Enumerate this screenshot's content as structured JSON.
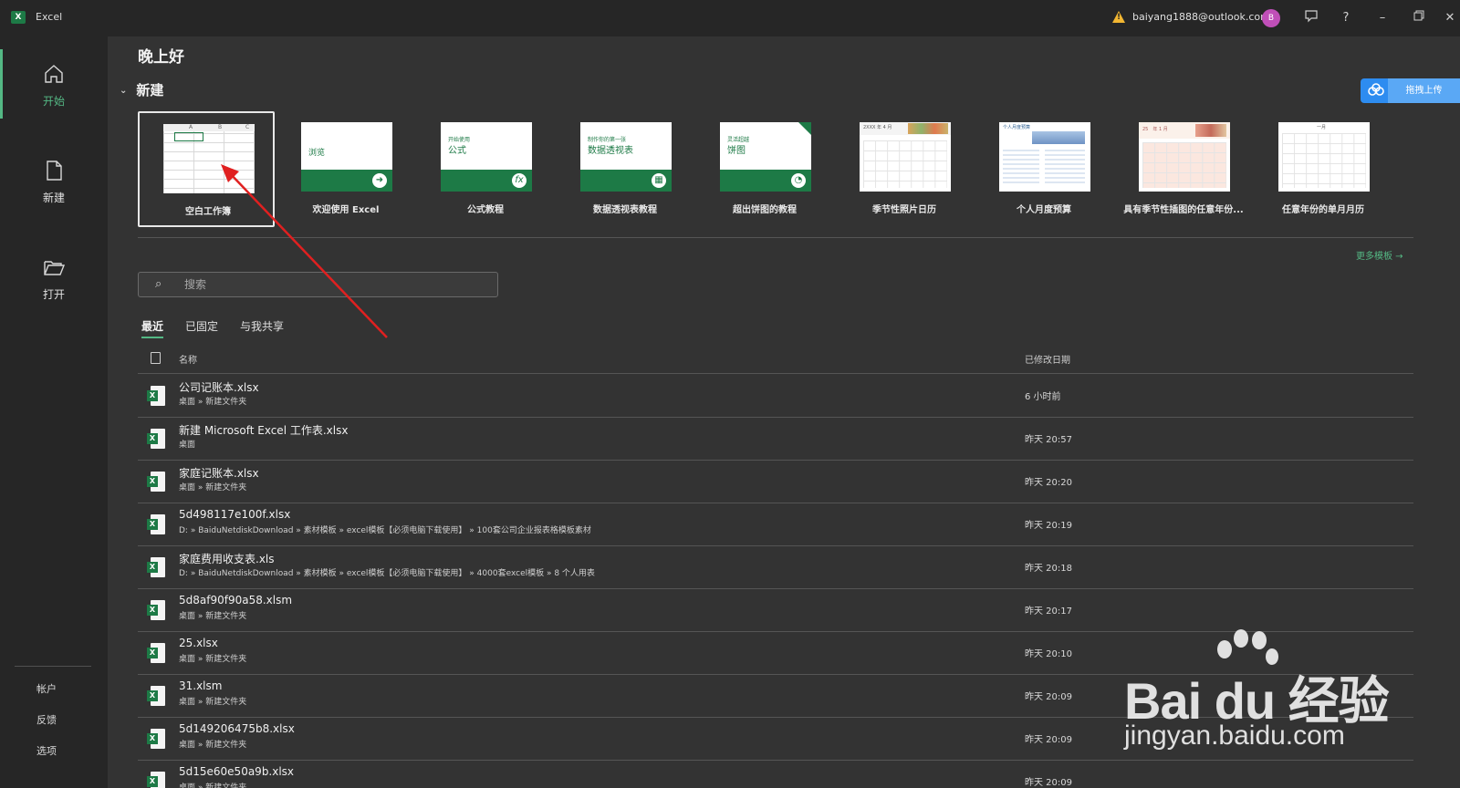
{
  "titlebar": {
    "app_name": "Excel",
    "app_logo": "X",
    "account_email": "baiyang1888@outlook.com",
    "avatar_initial": "B",
    "icons": [
      "warning-icon",
      "feedback-icon",
      "help-icon",
      "minimize-icon",
      "restore-icon",
      "close-icon"
    ]
  },
  "nav": {
    "items": [
      {
        "label": "开始",
        "icon": "home-icon"
      },
      {
        "label": "新建",
        "icon": "new-file-icon"
      },
      {
        "label": "打开",
        "icon": "folder-open-icon"
      }
    ],
    "bottom": [
      "帐户",
      "反馈",
      "选项"
    ]
  },
  "main": {
    "greeting": "晚上好",
    "new_section_title": "新建",
    "upload_button": "拖拽上传",
    "templates": [
      {
        "label": "空白工作簿",
        "thumb_text": ""
      },
      {
        "label": "欢迎使用 Excel",
        "thumb_text": "浏览"
      },
      {
        "label": "公式教程",
        "thumb_small": "开始使用",
        "thumb_big": "公式"
      },
      {
        "label": "数据透视表教程",
        "thumb_small": "制作你的第一张",
        "thumb_big": "数据透视表"
      },
      {
        "label": "超出饼图的教程",
        "thumb_small": "灵活超越",
        "thumb_big": "饼图"
      },
      {
        "label": "季节性照片日历",
        "thumb_small": "2XXX 年 4 月"
      },
      {
        "label": "个人月度预算",
        "thumb_small": "个人月度预算"
      },
      {
        "label": "具有季节性插图的任意年份...",
        "thumb_small": "25　年 1 月"
      },
      {
        "label": "任意年份的单月月历",
        "thumb_small": "一月"
      }
    ],
    "more_templates": "更多模板 →",
    "search_placeholder": "搜索",
    "tabs": [
      "最近",
      "已固定",
      "与我共享"
    ],
    "columns": {
      "name": "名称",
      "date": "已修改日期"
    },
    "files": [
      {
        "name": "公司记账本.xlsx",
        "path": "桌面 » 新建文件夹",
        "date": "6 小时前"
      },
      {
        "name": "新建 Microsoft Excel 工作表.xlsx",
        "path": "桌面",
        "date": "昨天 20:57"
      },
      {
        "name": "家庭记账本.xlsx",
        "path": "桌面 » 新建文件夹",
        "date": "昨天 20:20"
      },
      {
        "name": "5d498117e100f.xlsx",
        "path": "D: » BaiduNetdiskDownload » 素材模板 » excel模板【必须电脑下载使用】 » 100套公司企业报表格模板素材",
        "date": "昨天 20:19"
      },
      {
        "name": "家庭费用收支表.xls",
        "path": "D: » BaiduNetdiskDownload » 素材模板 » excel模板【必须电脑下载使用】 » 4000套excel模板 » 8 个人用表",
        "date": "昨天 20:18"
      },
      {
        "name": "5d8af90f90a58.xlsm",
        "path": "桌面 » 新建文件夹",
        "date": "昨天 20:17"
      },
      {
        "name": "25.xlsx",
        "path": "桌面 » 新建文件夹",
        "date": "昨天 20:10"
      },
      {
        "name": "31.xlsm",
        "path": "桌面 » 新建文件夹",
        "date": "昨天 20:09"
      },
      {
        "name": "5d149206475b8.xlsx",
        "path": "桌面 » 新建文件夹",
        "date": "昨天 20:09"
      },
      {
        "name": "5d15e60e50a9b.xlsx",
        "path": "桌面 » 新建文件夹",
        "date": "昨天 20:09"
      }
    ]
  },
  "watermark": {
    "brand": "Bai du 经验",
    "url": "jingyan.baidu.com"
  },
  "colors": {
    "accent": "#54b884",
    "excel_green": "#1d7a46",
    "upload_blue": "#2d8cf0",
    "annotation_red": "#e02020"
  }
}
